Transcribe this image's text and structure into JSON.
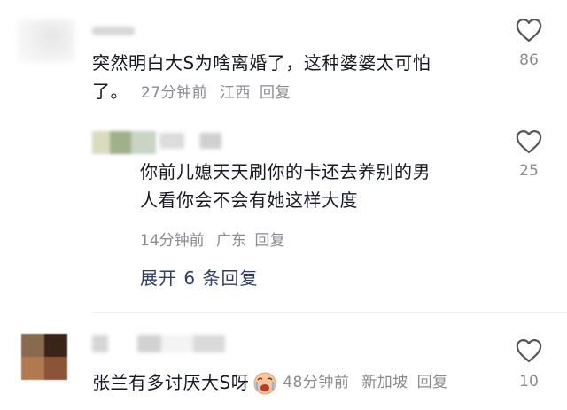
{
  "comments": [
    {
      "text_line1": "突然明白大S为啥离婚了，这种婆婆太可怕",
      "text_line2": "了。",
      "time": "27分钟前",
      "location": "江西",
      "reply_label": "回复",
      "likes": "86",
      "icon": "heart-outline-icon"
    },
    {
      "text_line1": "你前儿媳天天刷你的卡还去养别的男",
      "text_line2": "人看你会不会有她这样大度",
      "time": "14分钟前",
      "location": "广东",
      "reply_label": "回复",
      "likes": "25",
      "icon": "heart-outline-icon"
    },
    {
      "text": "张兰有多讨厌大S呀",
      "time": "48分钟前",
      "location": "新加坡",
      "reply_label": "回复",
      "likes": "10",
      "icon": "heart-outline-icon",
      "emoji": "crying-face-emoji"
    }
  ],
  "expand_replies": "展开 6 条回复",
  "colors": {
    "text": "#161823",
    "meta": "#8a8b91",
    "expand_link": "#2f3e6a"
  }
}
